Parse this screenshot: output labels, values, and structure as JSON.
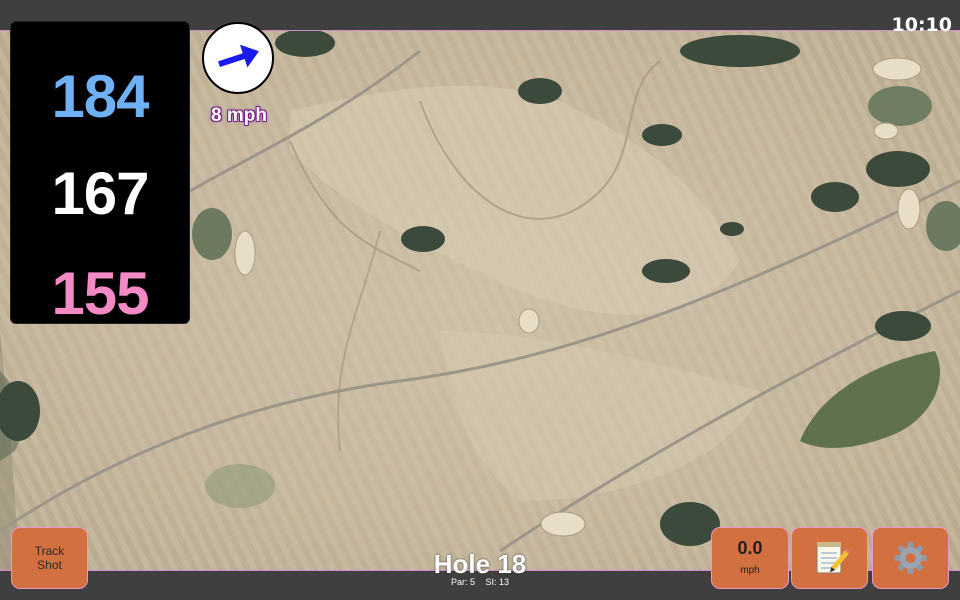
{
  "status_bar": {
    "time": "10:10"
  },
  "distances": {
    "back": "184",
    "middle": "167",
    "front": "155"
  },
  "wind": {
    "speed_label": "8 mph",
    "direction_icon": "arrow-icon"
  },
  "hole": {
    "title": "Hole 18",
    "par": "Par: 5",
    "si": "SI: 13"
  },
  "buttons": {
    "track_shot_label": "Track\nShot",
    "speed_value": "0.0",
    "speed_unit": "mph",
    "notes_icon": "notepad-icon",
    "settings_icon": "gear-icon"
  },
  "colors": {
    "back_distance": "#6fb1f5",
    "middle_distance": "#ffffff",
    "front_distance": "#f38ac5",
    "button_bg": "#d2703f",
    "wind_text_outline": "#7a1f8a"
  }
}
